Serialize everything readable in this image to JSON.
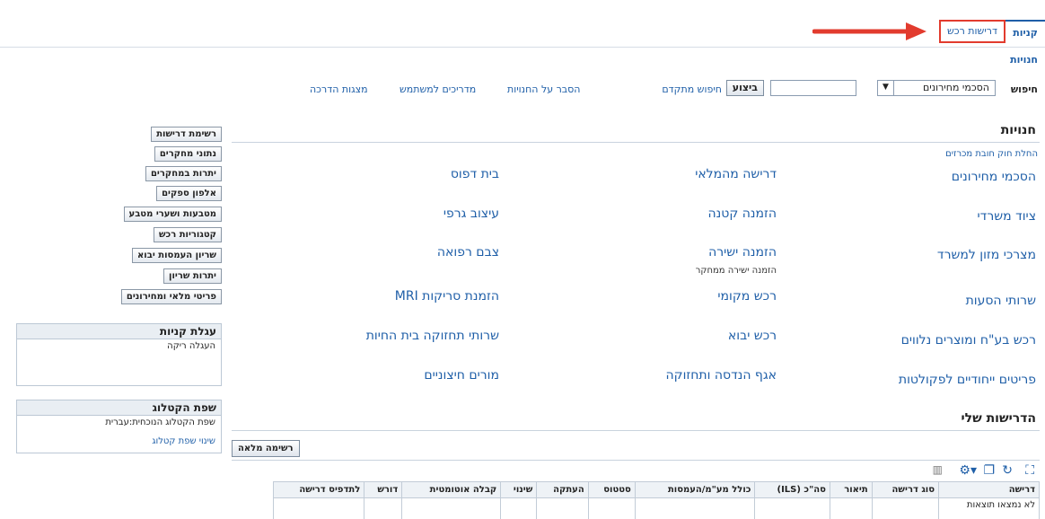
{
  "tabs": {
    "shops": "קניות",
    "requisitions": "דרישות רכש"
  },
  "subtitle": "חנויות",
  "search": {
    "label": "חיפוש",
    "selected": "הסכמי מחירונים",
    "go_label": "ביצוע",
    "advanced_link": "חיפוש מתקדם"
  },
  "top_links": {
    "explain": "הסבר על החנויות",
    "guides": "מדריכים למשתמש",
    "presentations": "מצגות הדרכה"
  },
  "stores_section": {
    "title": "חנויות",
    "law_link": "החלת חוק חובת מכרזים",
    "col1": [
      "הסכמי מחירונים",
      "ציוד משרדי",
      "מצרכי מזון למשרד",
      "שרותי הסעות",
      "רכש בע\"ח ומוצרים נלווים",
      "פריטים ייחודיים לפקולטות"
    ],
    "col2": [
      "דרישה מהמלאי",
      "הזמנה קטנה",
      "הזמנה ישירה",
      "רכש מקומי",
      "רכש יבוא",
      "אגף הנדסה ותחזוקה"
    ],
    "col2_sub": "הזמנה ישירה ממחקר",
    "col3": [
      "בית דפוס",
      "עיצוב גרפי",
      "צבם רפואה",
      "הזמנת סריקות MRI",
      "שרותי תחזוקה בית החיות",
      "מורים חיצוניים"
    ]
  },
  "sidebar_buttons": [
    "רשימת דרישות",
    "נתוני מחקרים",
    "יתרות במחקרים",
    "אלפון ספקים",
    "מטבעות ושערי מטבע",
    "קטגוריות רכש",
    "שריון העמסות יבוא",
    "יתרות שריון",
    "פריטי מלאי ומחירונים"
  ],
  "cart": {
    "title": "עגלת קניות",
    "empty": "העגלה ריקה"
  },
  "catalog_lang": {
    "title": "שפת הקטלוג",
    "current": "שפת הקטלוג הנוכחית:עברית",
    "change_link": "שינוי שפת קטלוג"
  },
  "my_requisitions": {
    "title": "הדרישות שלי",
    "full_list": "רשימה מלאה",
    "columns": [
      "דרישה",
      "סוג דרישה",
      "תיאור",
      "סה\"כ (ILS)",
      "כולל מע\"מ/העמסות",
      "סטטוס",
      "העתקה",
      "שינוי",
      "קבלה אוטומטית",
      "דורש",
      "לתדפיס דרישה"
    ],
    "empty_text": "לא נמצאו תוצאות"
  },
  "colors": {
    "link": "#1f5fa8",
    "highlight": "#e23b2e"
  },
  "icons": [
    "expand-icon",
    "refresh-icon",
    "detach-icon",
    "settings-icon",
    "columns-icon"
  ]
}
